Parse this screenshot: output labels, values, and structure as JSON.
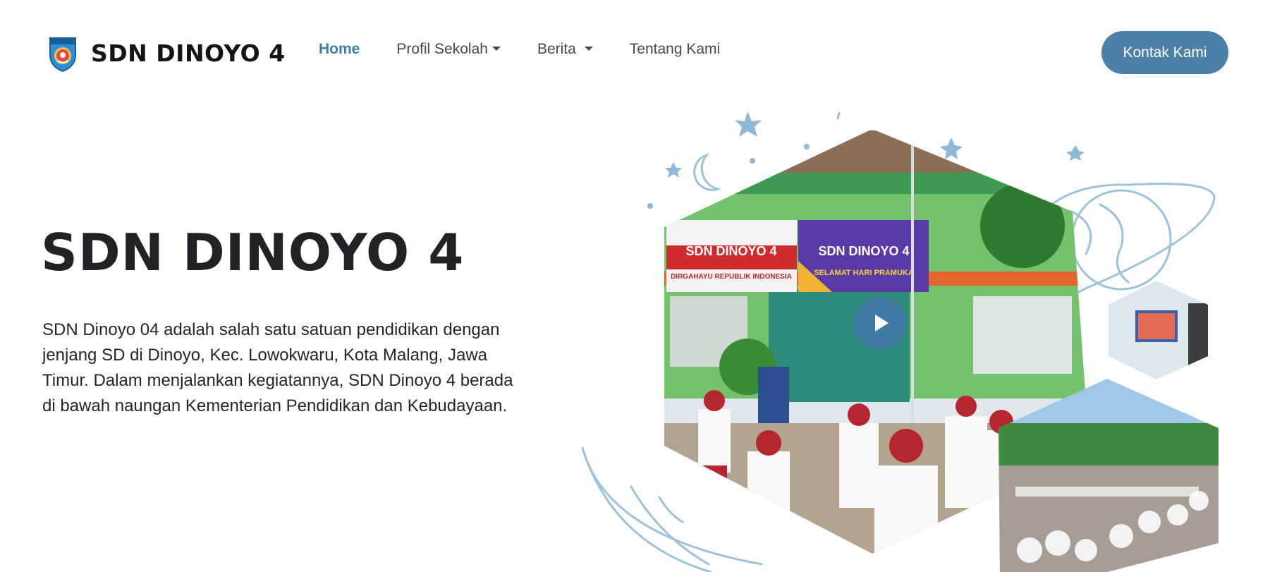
{
  "brand": {
    "name": "SDN DINOYO 4"
  },
  "nav": {
    "home": "Home",
    "profil": "Profil Sekolah",
    "berita": "Berita",
    "tentang": "Tentang Kami"
  },
  "cta": {
    "label": "Kontak Kami"
  },
  "hero": {
    "title": "SDN DINOYO 4",
    "description": "SDN Dinoyo 04 adalah salah satu satuan pendidikan dengan jenjang SD di Dinoyo, Kec. Lowokwaru, Kota Malang, Jawa Timur. Dalam menjalankan kegiatannya, SDN Dinoyo 4 berada di bawah naungan Kementerian Pendidikan dan Kebudayaan."
  },
  "banners": {
    "left_title": "SDN DINOYO 4",
    "left_sub": "DIRGAHAYU REPUBLIK INDONESIA",
    "right_title": "SDN DINOYO 4",
    "right_sub": "SELAMAT HARI PRAMUKA"
  },
  "colors": {
    "accent": "#4d80a8",
    "nav_active": "#3e7fae",
    "decor": "#9cc3dc"
  }
}
